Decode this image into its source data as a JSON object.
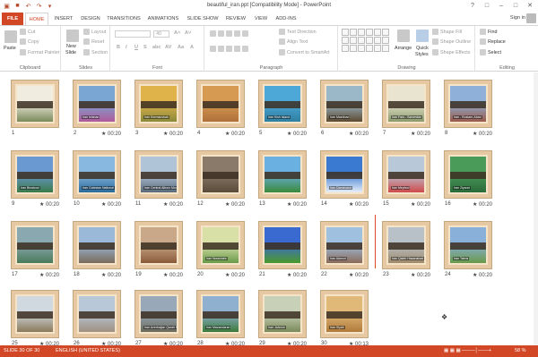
{
  "window": {
    "title": "beautiful_iran.ppt [Compatibility Mode] - PowerPoint",
    "controls": [
      "?",
      "□",
      "–",
      "□",
      "✕"
    ]
  },
  "tabs": [
    {
      "label": "FILE"
    },
    {
      "label": "HOME"
    },
    {
      "label": "INSERT"
    },
    {
      "label": "DESIGN"
    },
    {
      "label": "TRANSITIONS"
    },
    {
      "label": "ANIMATIONS"
    },
    {
      "label": "SLIDE SHOW"
    },
    {
      "label": "REVIEW"
    },
    {
      "label": "VIEW"
    },
    {
      "label": "ADD-INS"
    }
  ],
  "signin": "Sign in",
  "ribbon": {
    "clipboard": {
      "label": "Clipboard",
      "paste": "Paste",
      "cut": "Cut",
      "copy": "Copy",
      "format_painter": "Format Painter"
    },
    "slides": {
      "label": "Slides",
      "new_slide": "New",
      "new_slide2": "Slide",
      "layout": "Layout",
      "reset": "Reset",
      "section": "Section"
    },
    "font": {
      "label": "Font",
      "size": "40",
      "bold": "B",
      "italic": "I",
      "underline": "U",
      "strike": "S",
      "shadow": "abc",
      "spacing": "AV",
      "case": "Aa",
      "color": "A"
    },
    "paragraph": {
      "label": "Paragraph",
      "text_direction": "Text Direction",
      "align_text": "Align Text",
      "convert": "Convert to SmartArt"
    },
    "drawing": {
      "label": "Drawing",
      "arrange": "Arrange",
      "quick_styles": "Quick",
      "quick_styles2": "Styles",
      "shape_fill": "Shape Fill",
      "shape_outline": "Shape Outline",
      "shape_effects": "Shape Effects"
    },
    "editing": {
      "label": "Editing",
      "find": "Find",
      "replace": "Replace",
      "select": "Select"
    }
  },
  "slides": [
    {
      "num": "1",
      "time": "",
      "caption": "",
      "bg": "#f0ece0",
      "fg": "#7a8a5a"
    },
    {
      "num": "2",
      "time": "★ 00:20",
      "caption": "Iran Isfahan",
      "bg": "#7aa6d4",
      "fg": "#b05a9a"
    },
    {
      "num": "3",
      "time": "★ 00:20",
      "caption": "Iran Kermanshah",
      "bg": "#e0b24a",
      "fg": "#8a8a3a"
    },
    {
      "num": "4",
      "time": "★ 00:20",
      "caption": "",
      "bg": "#d79a52",
      "fg": "#b0703a"
    },
    {
      "num": "5",
      "time": "★ 00:20",
      "caption": "Iran Kish Island",
      "bg": "#4da8d8",
      "fg": "#2f7fa0"
    },
    {
      "num": "6",
      "time": "★ 00:20",
      "caption": "Iran Mashhad",
      "bg": "#9bb8c8",
      "fg": "#5d4a30"
    },
    {
      "num": "7",
      "time": "★ 00:20",
      "caption": "Iran Fars - Sarvestan",
      "bg": "#e8e4d0",
      "fg": "#8a9a6a"
    },
    {
      "num": "8",
      "time": "★ 00:20",
      "caption": "Iran - Rostam-Abad",
      "bg": "#8fb0d8",
      "fg": "#9a5a4a"
    },
    {
      "num": "9",
      "time": "★ 00:20",
      "caption": "Iran Binalood",
      "bg": "#6a98d0",
      "fg": "#3a7a4a"
    },
    {
      "num": "10",
      "time": "★ 00:20",
      "caption": "Iran Golestan National Park",
      "bg": "#88b8e0",
      "fg": "#2a6a9a"
    },
    {
      "num": "11",
      "time": "★ 00:20",
      "caption": "Iran Central Alborz Mountains",
      "bg": "#b0c4d8",
      "fg": "#5a6a7a"
    },
    {
      "num": "12",
      "time": "★ 00:20",
      "caption": "",
      "bg": "#8a7a6a",
      "fg": "#5a4a3a"
    },
    {
      "num": "13",
      "time": "★ 00:20",
      "caption": "",
      "bg": "#6ab0e0",
      "fg": "#3a8a3a"
    },
    {
      "num": "14",
      "time": "★ 00:20",
      "caption": "Iran Damavand",
      "bg": "#3a7ad0",
      "fg": "#e8eef8"
    },
    {
      "num": "15",
      "time": "★ 00:20",
      "caption": "Iran Meybod",
      "bg": "#b8c8d8",
      "fg": "#d04a4a"
    },
    {
      "num": "16",
      "time": "★ 00:20",
      "caption": "Iran Ziyarat",
      "bg": "#4a9a5a",
      "fg": "#2a6a3a"
    },
    {
      "num": "17",
      "time": "★ 00:20",
      "caption": "",
      "bg": "#8aa8b0",
      "fg": "#4a7a5a"
    },
    {
      "num": "18",
      "time": "★ 00:20",
      "caption": "",
      "bg": "#9ab8d8",
      "fg": "#7a6a5a"
    },
    {
      "num": "19",
      "time": "★ 00:20",
      "caption": "",
      "bg": "#c8a888",
      "fg": "#8a5a3a"
    },
    {
      "num": "20",
      "time": "★ 00:20",
      "caption": "Iran Nowshahr",
      "bg": "#d8e0a8",
      "fg": "#6a9a4a"
    },
    {
      "num": "21",
      "time": "★ 00:20",
      "caption": "",
      "bg": "#3a6ad0",
      "fg": "#4a9a2a"
    },
    {
      "num": "22",
      "time": "★ 00:20",
      "caption": "Iran Alamut",
      "bg": "#a0c0e0",
      "fg": "#8a6a5a"
    },
    {
      "num": "23",
      "time": "★ 00:20",
      "caption": "Iran Qaleh Hasanabad",
      "bg": "#b8c0c8",
      "fg": "#a08a6a"
    },
    {
      "num": "24",
      "time": "★ 00:20",
      "caption": "Iran Tabriz",
      "bg": "#88b0d8",
      "fg": "#6a9a4a"
    },
    {
      "num": "25",
      "time": "★ 00:20",
      "caption": "",
      "bg": "#d0d8e0",
      "fg": "#8a7a5a"
    },
    {
      "num": "26",
      "time": "★ 00:20",
      "caption": "",
      "bg": "#b8c8d8",
      "fg": "#a09080"
    },
    {
      "num": "27",
      "time": "★ 00:20",
      "caption": "Iran Azerbaijan Qarah Pasha",
      "bg": "#98a8b8",
      "fg": "#6a6a5a"
    },
    {
      "num": "28",
      "time": "★ 00:20",
      "caption": "Iran Mazandaran",
      "bg": "#90b0d0",
      "fg": "#3a7a3a"
    },
    {
      "num": "29",
      "time": "★ 00:20",
      "caption": "Iran Jahrom",
      "bg": "#c8d0b8",
      "fg": "#7a8a5a"
    },
    {
      "num": "30",
      "time": "★ 00:13",
      "caption": "Iran Siyah",
      "bg": "#e0b878",
      "fg": "#b07a3a"
    }
  ],
  "status": {
    "slide": "SLIDE 30 OF 30",
    "language": "ENGLISH (UNITED STATES)",
    "zoom": "58 %"
  }
}
